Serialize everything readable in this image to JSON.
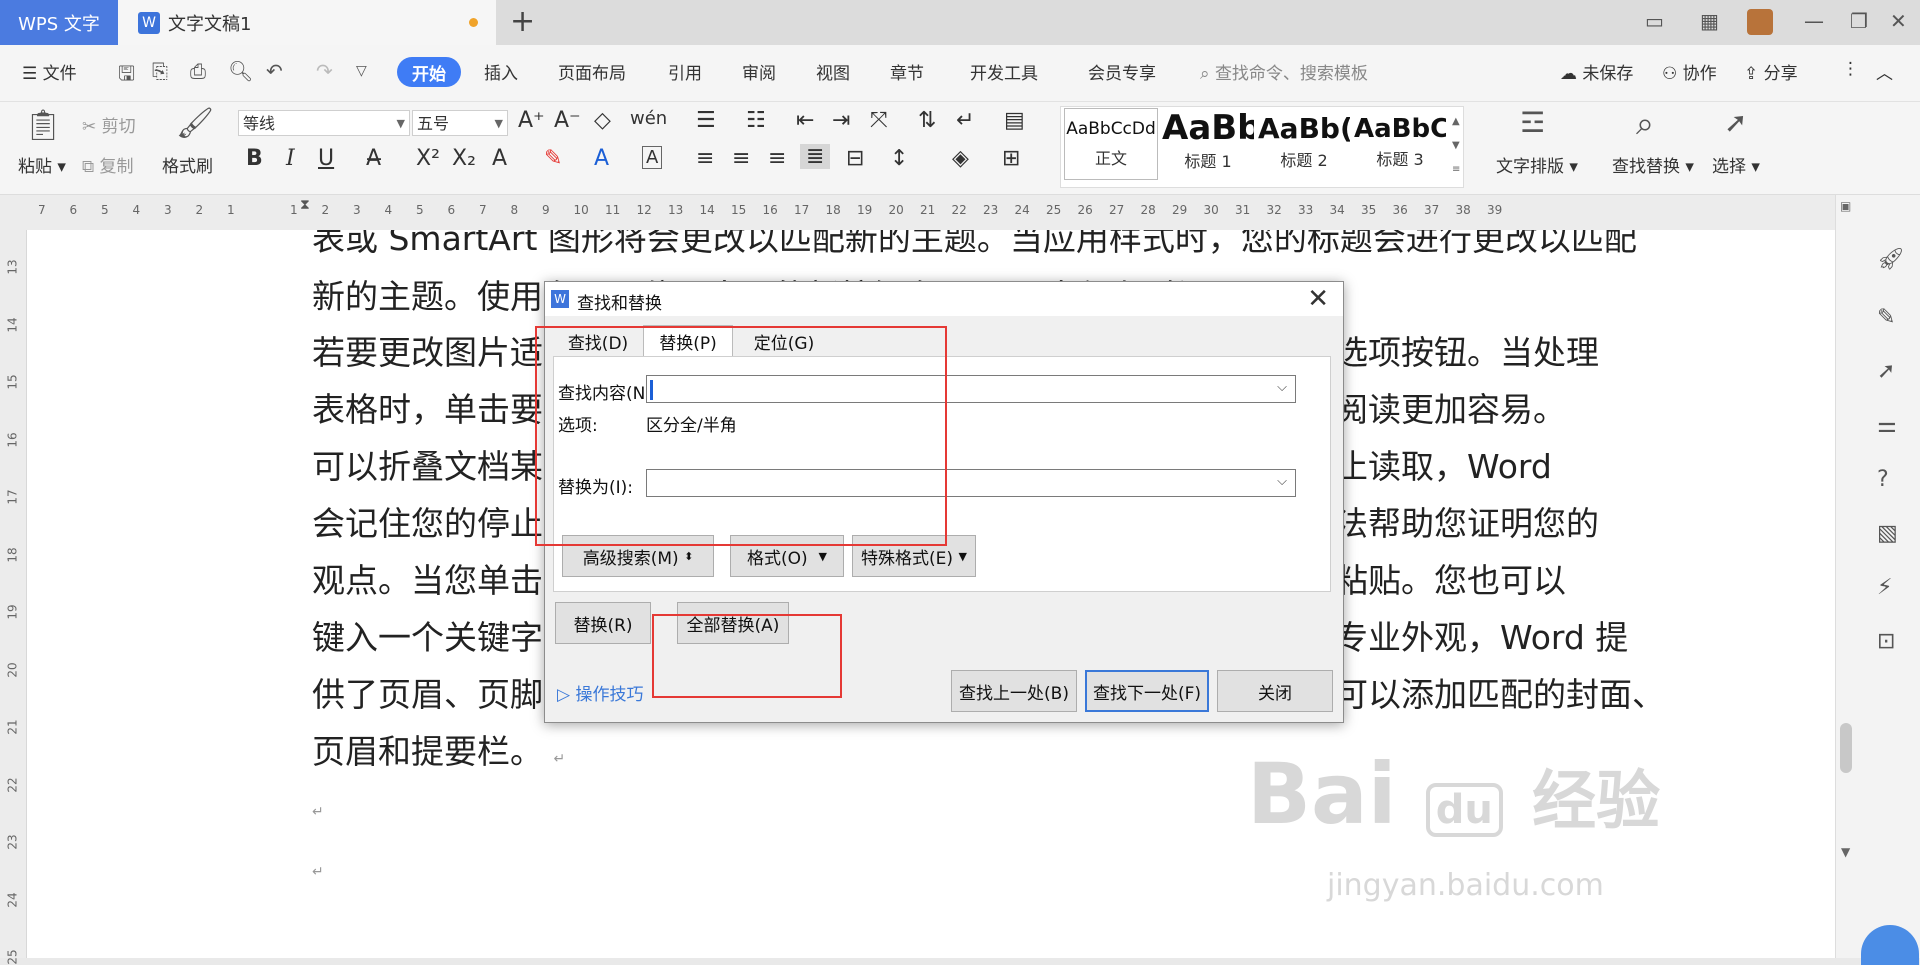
{
  "titlebar": {
    "app_label": "WPS 文字",
    "doc_tab": "文字文稿1",
    "new_tab": "+",
    "icons": [
      "layout-icon",
      "grid-icon",
      "avatar",
      "minimize-icon",
      "restore-icon",
      "close-icon"
    ]
  },
  "menubar": {
    "file": "文件",
    "items": [
      "开始",
      "插入",
      "页面布局",
      "引用",
      "审阅",
      "视图",
      "章节",
      "开发工具",
      "会员专享"
    ],
    "search_placeholder": "查找命令、搜索模板",
    "unsaved": "未保存",
    "collab": "协作",
    "share": "分享"
  },
  "ribbon": {
    "paste": "粘贴",
    "cut": "剪切",
    "copy": "复制",
    "format_painter": "格式刷",
    "font": "等线",
    "size": "五号",
    "styles": [
      {
        "preview": "AaBbCcDd",
        "label": "正文"
      },
      {
        "preview": "AaBb",
        "label": "标题 1"
      },
      {
        "preview": "AaBb(",
        "label": "标题 2"
      },
      {
        "preview": "AaBbC",
        "label": "标题 3"
      }
    ],
    "text_layout": "文字排版",
    "find_replace": "查找替换",
    "select": "选择"
  },
  "ruler": {
    "h_ticks": [
      "7",
      "6",
      "5",
      "4",
      "3",
      "2",
      "1",
      "",
      "1",
      "2",
      "3",
      "4",
      "5",
      "6",
      "7",
      "8",
      "9",
      "10",
      "11",
      "12",
      "13",
      "14",
      "15",
      "16",
      "17",
      "18",
      "19",
      "20",
      "21",
      "22",
      "23",
      "24",
      "25",
      "26",
      "27",
      "28",
      "29",
      "30",
      "31",
      "32",
      "33",
      "34",
      "35",
      "36",
      "37",
      "38",
      "39"
    ],
    "v_ticks": [
      "13",
      "14",
      "15",
      "16",
      "17",
      "18",
      "19",
      "20",
      "21",
      "22",
      "23",
      "24",
      "25"
    ]
  },
  "document": {
    "lines": [
      "表或 SmartArt 图形将会更改以匹配新的主题。当应用样式时，您的标题会进行更改以匹配",
      "新的主题。使用在需要位置出现的新按钮在 Word 中保存时间。",
      "若要更改图片适应文档的方式，请单击该图片，图片旁边将会显示布局选项按钮。当处理",
      "表格时，单击要添加行或列的位置，然后单击加号。在新的阅读视图中阅读更加容易。",
      "可以折叠文档某些部分并关注所需文本。如果在达到结尾处之前需要停止读取，Word",
      "会记住您的停止位置，即使在另一个设备上。视频提供了功能强大的方法帮助您证明您的",
      "观点。当您单击联机视频时，可以在想要添加的视频的嵌入代码中进行粘贴。您也可以",
      "键入一个关键字以联机搜索最适合您的文档的视频。为使您的文档具有专业外观，Word 提",
      "供了页眉、页脚、封面和文本框设计，这些设计可互为补充。例如，您可以添加匹配的封面、",
      "页眉和提要栏。"
    ],
    "para_mark": "↵"
  },
  "dialog": {
    "title": "查找和替换",
    "tabs": [
      "查找(D)",
      "替换(P)",
      "定位(G)"
    ],
    "find_label": "查找内容(N):",
    "find_value": "",
    "options_label": "选项:",
    "options_value": "区分全/半角",
    "replace_label": "替换为(I):",
    "replace_value": "",
    "advanced_search": "高级搜索(M)",
    "format": "格式(O)",
    "special_format": "特殊格式(E)",
    "replace_btn": "替换(R)",
    "replace_all_btn": "全部替换(A)",
    "tips": "操作技巧",
    "find_prev": "查找上一处(B)",
    "find_next": "查找下一处(F)",
    "close": "关闭"
  },
  "watermark": {
    "brand": "Bai",
    "brand2": "经验",
    "url": "jingyan.baidu.com"
  },
  "colors": {
    "accent": "#3f7cf5",
    "highlight_box": "#e53935"
  }
}
